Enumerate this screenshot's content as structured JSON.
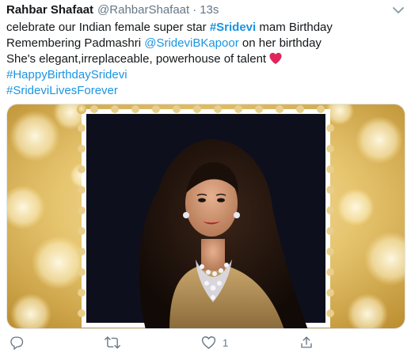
{
  "tweet": {
    "author_name": "Rahbar Shafaat",
    "handle": "@RahbarShafaat",
    "separator": "·",
    "time": "13s",
    "lines": {
      "l1_pre": "celebrate our Indian female super star ",
      "l1_hashtag": "#Sridevi",
      "l1_post": " mam Birthday",
      "l2_pre": "Remembering Padmashri ",
      "l2_mention": "@SrideviBKapoor",
      "l2_post": " on her birthday",
      "l3_text": "She's elegant,irreplaceable, powerhouse of talent",
      "l4_hashtag": "#HappyBirthdaySridevi",
      "l5_hashtag": "#SrideviLivesForever"
    },
    "emoji": "red-heart-icon",
    "media": "photo-of-woman-in-framed-stamp-border-on-gold-bokeh-background",
    "actions": {
      "reply_icon": "reply-icon",
      "retweet_icon": "retweet-icon",
      "like_icon": "like-icon",
      "like_count": "1",
      "share_icon": "share-icon"
    }
  },
  "colors": {
    "link": "#1b95e0",
    "secondary_text": "#657786",
    "primary_text": "#14171a",
    "heart": "#e0245e"
  }
}
